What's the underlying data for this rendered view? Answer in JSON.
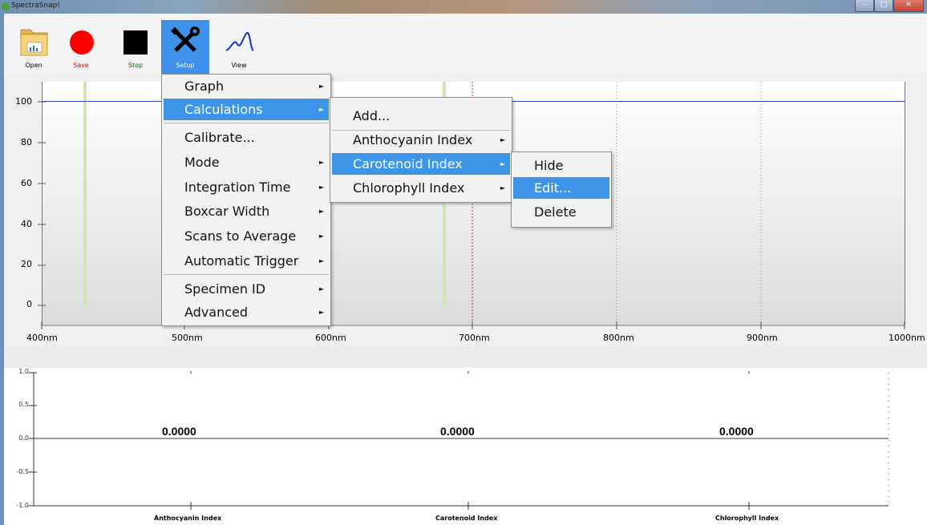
{
  "window": {
    "title": "SpectraSnap!"
  },
  "toolbar": {
    "open_label": "Open",
    "save_label": "Save",
    "stop_label": "Stop",
    "setup_label": "Setup",
    "view_label": "View",
    "save_color": "#ff0000",
    "setup_active_color": "#3f91ea"
  },
  "setup_menu": {
    "items": [
      {
        "label": "Graph",
        "submenu": true
      },
      {
        "label": "Calculations",
        "submenu": true,
        "selected": true
      },
      {
        "label": "Calibrate...",
        "submenu": false
      },
      {
        "label": "Mode",
        "submenu": true
      },
      {
        "label": "Integration Time",
        "submenu": true
      },
      {
        "label": "Boxcar Width",
        "submenu": true
      },
      {
        "label": "Scans to Average",
        "submenu": true
      },
      {
        "label": "Automatic Trigger",
        "submenu": true
      },
      {
        "label": "Specimen ID",
        "submenu": true
      },
      {
        "label": "Advanced",
        "submenu": true
      }
    ]
  },
  "calculations_menu": {
    "items": [
      {
        "label": "Add..."
      },
      {
        "label": "Anthocyanin Index",
        "submenu": true
      },
      {
        "label": "Carotenoid Index",
        "submenu": true,
        "selected": true
      },
      {
        "label": "Chlorophyll Index",
        "submenu": true
      }
    ]
  },
  "carotenoid_menu": {
    "items": [
      {
        "label": "Hide"
      },
      {
        "label": "Edit...",
        "selected": true
      },
      {
        "label": "Delete"
      }
    ]
  },
  "spectrum_plot": {
    "y_ticks": [
      "100",
      "80",
      "60",
      "40",
      "20",
      "0"
    ],
    "x_ticks": [
      "400nm",
      "500nm",
      "600nm",
      "700nm",
      "800nm",
      "900nm",
      "1000nm"
    ],
    "line_value": 100
  },
  "index_plot": {
    "y_ticks": [
      "1.0",
      "0.5",
      "0.0",
      "-0.5",
      "-1.0"
    ],
    "categories": [
      "Anthocyanin Index",
      "Carotenoid Index",
      "Chlorophyll Index"
    ],
    "values": [
      "0.0000",
      "0.0000",
      "0.0000"
    ]
  }
}
